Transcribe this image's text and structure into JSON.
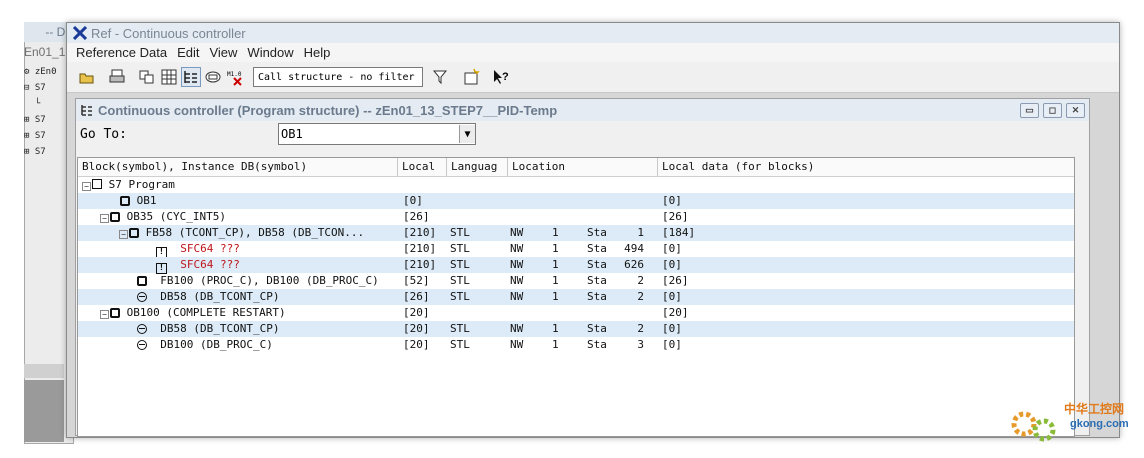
{
  "background_window": {
    "title": "-- D:\\",
    "tab": "En01_1",
    "tree_items": [
      "zEn0",
      "",
      "",
      "",
      "",
      ""
    ]
  },
  "window": {
    "title": "Ref - Continuous controller",
    "menu": [
      "Reference Data",
      "Edit",
      "View",
      "Window",
      "Help"
    ],
    "filter_value": "Call structure - no filter"
  },
  "child": {
    "title": "Continuous controller (Program structure) -- zEn01_13_STEP7__PID-Temp",
    "goto_label": "Go To:",
    "goto_value": "OB1",
    "columns": [
      "Block(symbol), Instance DB(symbol)",
      "Local",
      "Languag",
      "Location",
      "Local data (for blocks)"
    ]
  },
  "rows": [
    {
      "block": "S7 Program",
      "local": "",
      "lang": "",
      "nw": "",
      "n": "",
      "sta": "",
      "num": "",
      "ld": ""
    },
    {
      "block": "OB1",
      "local": "[0]",
      "lang": "",
      "nw": "",
      "n": "",
      "sta": "",
      "num": "",
      "ld": "[0]"
    },
    {
      "block": "OB35 (CYC_INT5)",
      "local": "[26]",
      "lang": "",
      "nw": "",
      "n": "",
      "sta": "",
      "num": "",
      "ld": "[26]"
    },
    {
      "block": "FB58 (TCONT_CP), DB58 (DB_TCON...",
      "local": "[210]",
      "lang": "STL",
      "nw": "NW",
      "n": "1",
      "sta": "Sta",
      "num": "1",
      "ld": "[184]"
    },
    {
      "block": "SFC64 ???",
      "local": "[210]",
      "lang": "STL",
      "nw": "NW",
      "n": "1",
      "sta": "Sta",
      "num": "494",
      "ld": "[0]"
    },
    {
      "block": "SFC64 ???",
      "local": "[210]",
      "lang": "STL",
      "nw": "NW",
      "n": "1",
      "sta": "Sta",
      "num": "626",
      "ld": "[0]"
    },
    {
      "block": "FB100 (PROC_C), DB100 (DB_PROC_C)",
      "local": "[52]",
      "lang": "STL",
      "nw": "NW",
      "n": "1",
      "sta": "Sta",
      "num": "2",
      "ld": "[26]"
    },
    {
      "block": "DB58 (DB_TCONT_CP)",
      "local": "[26]",
      "lang": "STL",
      "nw": "NW",
      "n": "1",
      "sta": "Sta",
      "num": "2",
      "ld": "[0]"
    },
    {
      "block": "OB100 (COMPLETE RESTART)",
      "local": "[20]",
      "lang": "",
      "nw": "",
      "n": "",
      "sta": "",
      "num": "",
      "ld": "[20]"
    },
    {
      "block": "DB58 (DB_TCONT_CP)",
      "local": "[20]",
      "lang": "STL",
      "nw": "NW",
      "n": "1",
      "sta": "Sta",
      "num": "2",
      "ld": "[0]"
    },
    {
      "block": "DB100 (DB_PROC_C)",
      "local": "[20]",
      "lang": "STL",
      "nw": "NW",
      "n": "1",
      "sta": "Sta",
      "num": "3",
      "ld": "[0]"
    }
  ],
  "watermark": {
    "line1": "中华工控网",
    "line2": "gkong.com"
  },
  "colors": {
    "highlight_row": "#dcebf7",
    "missing_block": "#c0141b"
  }
}
